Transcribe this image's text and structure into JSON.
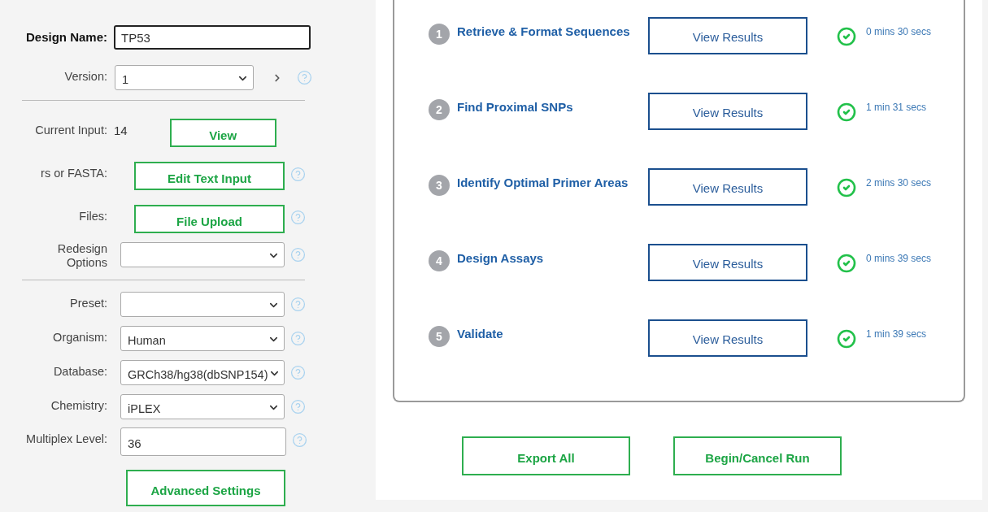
{
  "form": [
    {
      "kind": "name",
      "label": "Design Name:",
      "value": "TP53"
    },
    {
      "kind": "version",
      "label": "Version:",
      "value": "1",
      "help": true
    },
    {
      "kind": "divider"
    },
    {
      "kind": "count",
      "label": "Current Input:",
      "value": "14",
      "button": "View"
    },
    {
      "kind": "button",
      "label": "rs or FASTA:",
      "button": "Edit Text Input",
      "help": true
    },
    {
      "kind": "button",
      "label": "Files:",
      "button": "File Upload",
      "help": true
    },
    {
      "kind": "select",
      "label": "Redesign Options",
      "help": true
    },
    {
      "kind": "divider"
    },
    {
      "kind": "select",
      "label": "Preset:",
      "help": true
    },
    {
      "kind": "select",
      "label": "Organism:",
      "value": "Human",
      "help": true
    },
    {
      "kind": "select",
      "label": "Database:",
      "value": "GRCh38/hg38(dbSNP154)",
      "help": true
    },
    {
      "kind": "select",
      "label": "Chemistry:",
      "value": "iPLEX",
      "help": true
    },
    {
      "kind": "input",
      "label": "Multiplex Level:",
      "value": "36",
      "help": true
    },
    {
      "kind": "action",
      "button": "Advanced Settings"
    }
  ],
  "steps": [
    {
      "number": "1",
      "title": "Retrieve & Format Sequences",
      "button": "View Results",
      "done": true,
      "time": "0 mins 30 secs"
    },
    {
      "number": "2",
      "title": "Find Proximal SNPs",
      "button": "View Results",
      "done": true,
      "time": "1 min 31 secs"
    },
    {
      "number": "3",
      "title": "Identify Optimal Primer Areas",
      "button": "View Results",
      "done": true,
      "time": "2 mins 30 secs"
    },
    {
      "number": "4",
      "title": "Design Assays",
      "button": "View Results",
      "done": true,
      "time": "0 mins 39 secs"
    },
    {
      "number": "5",
      "title": "Validate",
      "button": "View Results",
      "done": true,
      "time": "1 min 39 secs"
    }
  ],
  "actions": [
    "Export All",
    "Begin/Cancel Run"
  ]
}
